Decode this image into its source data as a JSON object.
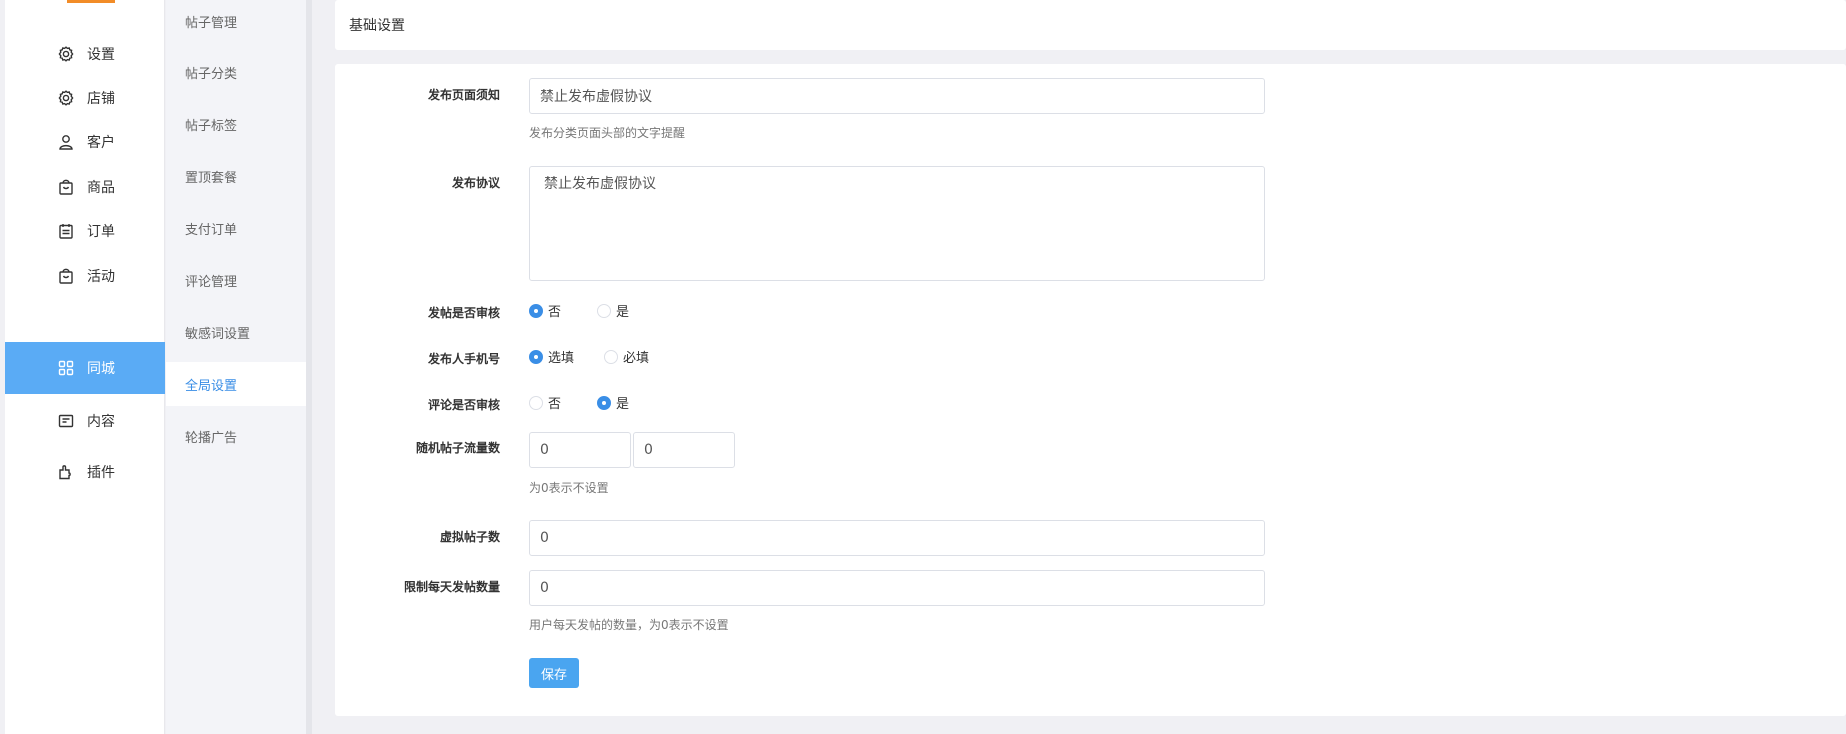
{
  "main_nav": [
    {
      "label": "设置",
      "icon": "gear-icon"
    },
    {
      "label": "店铺",
      "icon": "gear-icon"
    },
    {
      "label": "客户",
      "icon": "user-icon"
    },
    {
      "label": "商品",
      "icon": "bag-icon"
    },
    {
      "label": "订单",
      "icon": "calendar-icon"
    },
    {
      "label": "活动",
      "icon": "bag-icon"
    },
    {
      "label": "同城",
      "icon": "grid-icon",
      "active": true
    },
    {
      "label": "内容",
      "icon": "document-icon"
    },
    {
      "label": "插件",
      "icon": "puzzle-icon"
    }
  ],
  "sub_nav": [
    {
      "label": "帖子管理"
    },
    {
      "label": "帖子分类"
    },
    {
      "label": "帖子标签"
    },
    {
      "label": "置顶套餐"
    },
    {
      "label": "支付订单"
    },
    {
      "label": "评论管理"
    },
    {
      "label": "敏感词设置"
    },
    {
      "label": "全局设置",
      "active": true
    },
    {
      "label": "轮播广告"
    }
  ],
  "header": {
    "title": "基础设置"
  },
  "form": {
    "notice": {
      "label": "发布页面须知",
      "value": "禁止发布虚假协议",
      "help": "发布分类页面头部的文字提醒"
    },
    "agreement": {
      "label": "发布协议",
      "value": "禁止发布虚假协议"
    },
    "post_review": {
      "label": "发帖是否审核",
      "options": [
        "否",
        "是"
      ],
      "selected": "否"
    },
    "phone": {
      "label": "发布人手机号",
      "options": [
        "选填",
        "必填"
      ],
      "selected": "选填"
    },
    "comment_review": {
      "label": "评论是否审核",
      "options": [
        "否",
        "是"
      ],
      "selected": "是"
    },
    "random_traffic": {
      "label": "随机帖子流量数",
      "min": "0",
      "max": "0",
      "help": "为0表示不设置"
    },
    "virtual_posts": {
      "label": "虚拟帖子数",
      "value": "0"
    },
    "daily_limit": {
      "label": "限制每天发帖数量",
      "value": "0",
      "help": "用户每天发帖的数量，为0表示不设置"
    },
    "save_label": "保存"
  },
  "colors": {
    "accent": "#5aabf5",
    "primary": "#3a8ee6",
    "logo": "#f28c28"
  }
}
